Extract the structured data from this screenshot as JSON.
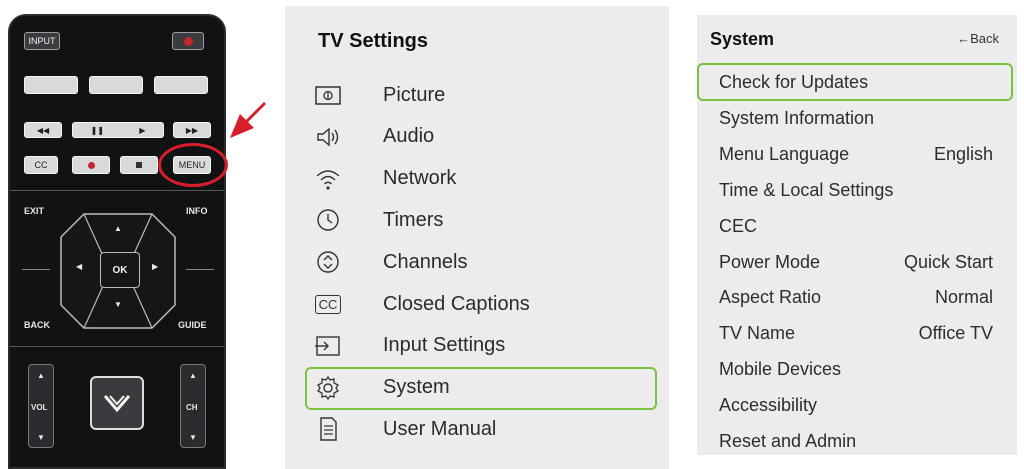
{
  "colors": {
    "highlight": "#7cc242",
    "callout_red": "#d81e2a",
    "panel_bg": "#ececec",
    "remote_body": "#111214"
  },
  "remote": {
    "input_label": "INPUT",
    "cc_label": "CC",
    "menu_label": "MENU",
    "exit_label": "EXIT",
    "info_label": "INFO",
    "ok_label": "OK",
    "back_label": "BACK",
    "guide_label": "GUIDE",
    "vol_label": "VOL",
    "ch_label": "CH"
  },
  "tv_settings": {
    "title": "TV Settings",
    "items": [
      {
        "label": "Picture",
        "icon": "picture-icon"
      },
      {
        "label": "Audio",
        "icon": "audio-icon"
      },
      {
        "label": "Network",
        "icon": "network-icon"
      },
      {
        "label": "Timers",
        "icon": "timers-icon"
      },
      {
        "label": "Channels",
        "icon": "channels-icon"
      },
      {
        "label": "Closed Captions",
        "icon": "closed-captions-icon",
        "icon_text": "CC"
      },
      {
        "label": "Input Settings",
        "icon": "input-settings-icon"
      },
      {
        "label": "System",
        "icon": "gear-icon",
        "selected": true
      },
      {
        "label": "User Manual",
        "icon": "user-manual-icon"
      }
    ]
  },
  "system": {
    "title": "System",
    "back_label": "←Back",
    "items": [
      {
        "label": "Check for Updates",
        "value": "",
        "selected": true
      },
      {
        "label": "System Information",
        "value": ""
      },
      {
        "label": "Menu Language",
        "value": "English"
      },
      {
        "label": "Time & Local Settings",
        "value": ""
      },
      {
        "label": "CEC",
        "value": ""
      },
      {
        "label": "Power Mode",
        "value": "Quick Start"
      },
      {
        "label": "Aspect Ratio",
        "value": "Normal"
      },
      {
        "label": "TV Name",
        "value": "Office TV"
      },
      {
        "label": "Mobile Devices",
        "value": ""
      },
      {
        "label": "Accessibility",
        "value": ""
      },
      {
        "label": "Reset and Admin",
        "value": ""
      }
    ]
  }
}
